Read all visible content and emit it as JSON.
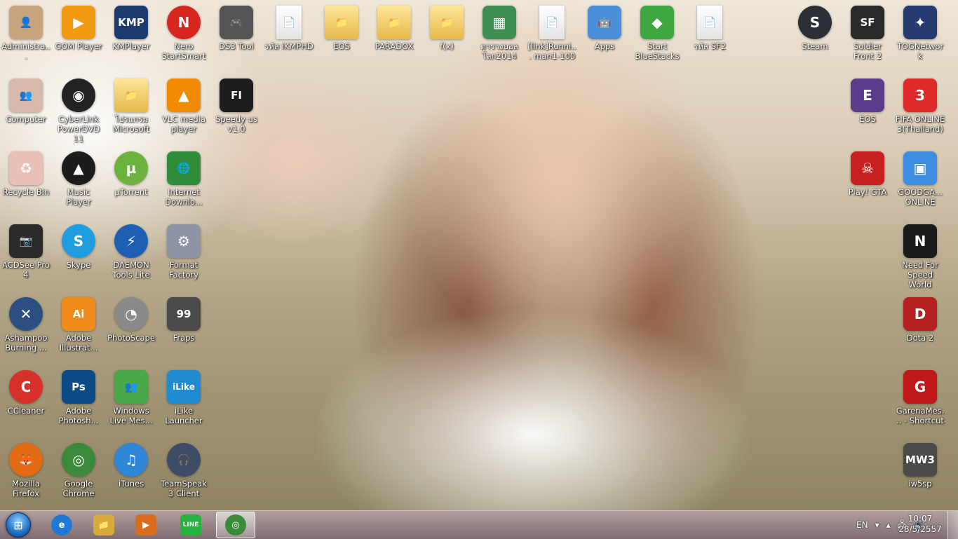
{
  "desktop": {
    "icons": [
      {
        "id": "admin",
        "label": "Administra...",
        "icon": "user-photo-icon",
        "glyph": "👤",
        "bg": "#c9a27e"
      },
      {
        "id": "gom",
        "label": "GOM Player",
        "icon": "gom-player-icon",
        "glyph": "▶",
        "bg": "#f39a14"
      },
      {
        "id": "kmp",
        "label": "KMPlayer",
        "icon": "kmplayer-icon",
        "glyph": "KMP",
        "bg": "#1c3c6e"
      },
      {
        "id": "nero",
        "label": "Nero StartSmart",
        "icon": "nero-icon",
        "glyph": "N",
        "bg": "#d7261e"
      },
      {
        "id": "ds3",
        "label": "DS3 Tool",
        "icon": "gamepad-icon",
        "glyph": "🎮",
        "bg": "#555555"
      },
      {
        "id": "kmphd",
        "label": "รหัส iKMPHD",
        "icon": "document-icon",
        "glyph": "📄",
        "bg": ""
      },
      {
        "id": "eos",
        "label": "EOS",
        "icon": "folder-icon",
        "glyph": "📁",
        "bg": ""
      },
      {
        "id": "paradox",
        "label": "PARADOX",
        "icon": "folder-icon",
        "glyph": "📁",
        "bg": ""
      },
      {
        "id": "fx",
        "label": "f(x)",
        "icon": "folder-icon",
        "glyph": "📁",
        "bg": ""
      },
      {
        "id": "ball",
        "label": "ตารางบอลโลก2014",
        "icon": "spreadsheet-icon",
        "glyph": "▦",
        "bg": "#3f8f55"
      },
      {
        "id": "link",
        "label": "[link]Runni... man1-100",
        "icon": "document-icon",
        "glyph": "📄",
        "bg": ""
      },
      {
        "id": "apps",
        "label": "Apps",
        "icon": "android-apps-icon",
        "glyph": "🤖",
        "bg": "#4a8fd8"
      },
      {
        "id": "bluestacks",
        "label": "Start BlueStacks",
        "icon": "bluestacks-icon",
        "glyph": "◆",
        "bg": "#3fa73f"
      },
      {
        "id": "sf2txt",
        "label": "รหัส SF2",
        "icon": "document-icon",
        "glyph": "📄",
        "bg": ""
      },
      {
        "id": "steam",
        "label": "Steam",
        "icon": "steam-icon",
        "glyph": "S",
        "bg": "#2b2f36"
      },
      {
        "id": "sf2",
        "label": "Soldier Front 2",
        "icon": "soldier-front-icon",
        "glyph": "SF",
        "bg": "#2a2a2a"
      },
      {
        "id": "tog",
        "label": "TOGNetwork",
        "icon": "tog-network-icon",
        "glyph": "✦",
        "bg": "#263c70"
      },
      {
        "id": "computer",
        "label": "Computer",
        "icon": "computer-icon",
        "glyph": "👥",
        "bg": "#d8b8a8"
      },
      {
        "id": "powerdvd",
        "label": "CyberLink PowerDVD 11",
        "icon": "powerdvd-icon",
        "glyph": "◉",
        "bg": "#222222"
      },
      {
        "id": "msfolder",
        "label": "โปรแกรม Microsoft",
        "icon": "folder-icon",
        "glyph": "📁",
        "bg": ""
      },
      {
        "id": "vlc",
        "label": "VLC media player",
        "icon": "vlc-icon",
        "glyph": "▲",
        "bg": "#f08a00"
      },
      {
        "id": "speedy",
        "label": "Speedy us v1.0",
        "icon": "speedy-icon",
        "glyph": "FI",
        "bg": "#1e1e1e"
      },
      {
        "id": "eos2",
        "label": "EOS",
        "icon": "eos-game-icon",
        "glyph": "E",
        "bg": "#5a3b8c"
      },
      {
        "id": "fifa",
        "label": "FIFA ONLINE 3(Thailand)",
        "icon": "fifa-online-icon",
        "glyph": "3",
        "bg": "#e02a2a"
      },
      {
        "id": "recycle",
        "label": "Recycle Bin",
        "icon": "recycle-bin-icon",
        "glyph": "♻",
        "bg": "#e9c0b6"
      },
      {
        "id": "music",
        "label": "Music Player",
        "icon": "music-player-icon",
        "glyph": "▲",
        "bg": "#1c1c1c"
      },
      {
        "id": "utorrent",
        "label": "µTorrent",
        "icon": "utorrent-icon",
        "glyph": "µ",
        "bg": "#6cb23d"
      },
      {
        "id": "idm",
        "label": "Internet Downlo...",
        "icon": "internet-download-icon",
        "glyph": "🌐",
        "bg": "#2f8c3a"
      },
      {
        "id": "gta",
        "label": "Play! GTA",
        "icon": "gta-icon",
        "glyph": "☠",
        "bg": "#c62020"
      },
      {
        "id": "goodgame",
        "label": "GOODGA... ONLINE",
        "icon": "goodgame-icon",
        "glyph": "▣",
        "bg": "#3b8ee0"
      },
      {
        "id": "acdsee",
        "label": "ACDSee Pro 4",
        "icon": "camera-icon",
        "glyph": "📷",
        "bg": "#2a2a2a"
      },
      {
        "id": "skype",
        "label": "Skype",
        "icon": "skype-icon",
        "glyph": "S",
        "bg": "#1e9ee0"
      },
      {
        "id": "daemon",
        "label": "DAEMON Tools Lite",
        "icon": "daemon-tools-icon",
        "glyph": "⚡",
        "bg": "#1f5fb3"
      },
      {
        "id": "format",
        "label": "Format Factory",
        "icon": "format-factory-icon",
        "glyph": "⚙",
        "bg": "#8c94a6"
      },
      {
        "id": "nfs",
        "label": "Need For Speed World",
        "icon": "nfs-icon",
        "glyph": "N",
        "bg": "#1a1a1a"
      },
      {
        "id": "ashampoo",
        "label": "Ashampoo Burning ...",
        "icon": "ashampoo-icon",
        "glyph": "✕",
        "bg": "#2a4f80"
      },
      {
        "id": "illustrator",
        "label": "Adobe Illustrat...",
        "icon": "illustrator-icon",
        "glyph": "Ai",
        "bg": "#f08a18"
      },
      {
        "id": "photoscape",
        "label": "PhotoScape",
        "icon": "photoscape-icon",
        "glyph": "◔",
        "bg": "#8a8a8a"
      },
      {
        "id": "fraps",
        "label": "Fraps",
        "icon": "fraps-icon",
        "glyph": "99",
        "bg": "#4a4a4a"
      },
      {
        "id": "dota",
        "label": "Dota 2",
        "icon": "dota2-icon",
        "glyph": "D",
        "bg": "#b41f1f"
      },
      {
        "id": "ccleaner",
        "label": "CCleaner",
        "icon": "ccleaner-icon",
        "glyph": "C",
        "bg": "#d8302a"
      },
      {
        "id": "photoshop",
        "label": "Adobe Photosh...",
        "icon": "photoshop-icon",
        "glyph": "Ps",
        "bg": "#0d4a86"
      },
      {
        "id": "wlm",
        "label": "Windows Live Mes...",
        "icon": "messenger-icon",
        "glyph": "👥",
        "bg": "#49a84a"
      },
      {
        "id": "ilike",
        "label": "iLike Launcher",
        "icon": "ilike-icon",
        "glyph": "iLike",
        "bg": "#1f8bd0"
      },
      {
        "id": "garena",
        "label": "GarenaMes... - Shortcut",
        "icon": "garena-icon",
        "glyph": "G",
        "bg": "#c01818"
      },
      {
        "id": "firefox",
        "label": "Mozilla Firefox",
        "icon": "firefox-icon",
        "glyph": "🦊",
        "bg": "#e36b14"
      },
      {
        "id": "chrome",
        "label": "Google Chrome",
        "icon": "chrome-icon",
        "glyph": "◎",
        "bg": "#3a8a3a"
      },
      {
        "id": "itunes",
        "label": "iTunes",
        "icon": "itunes-icon",
        "glyph": "♫",
        "bg": "#2f86d6"
      },
      {
        "id": "teamspeak",
        "label": "TeamSpeak 3 Client",
        "icon": "teamspeak-icon",
        "glyph": "🎧",
        "bg": "#3d4b66"
      },
      {
        "id": "iw5sp",
        "label": "iw5sp",
        "icon": "call-of-duty-icon",
        "glyph": "MW3",
        "bg": "#4a4a4a"
      }
    ]
  },
  "taskbar": {
    "start_glyph": "⊞",
    "pinned": [
      {
        "name": "internet-explorer",
        "icon": "internet-explorer-icon",
        "glyph": "e",
        "bg": "#1f78d6"
      },
      {
        "name": "windows-explorer",
        "icon": "folder-icon",
        "glyph": "📁",
        "bg": "#d8aa3c"
      },
      {
        "name": "media-player",
        "icon": "media-player-icon",
        "glyph": "▶",
        "bg": "#d86d1f"
      },
      {
        "name": "line",
        "icon": "line-icon",
        "glyph": "LINE",
        "bg": "#25b33d"
      },
      {
        "name": "chrome",
        "icon": "chrome-icon",
        "glyph": "◎",
        "bg": "#3a8a3a"
      }
    ],
    "tray": {
      "language": "EN",
      "flag_glyph": "▾",
      "arrow_glyph": "▴",
      "network_glyph": "🖧",
      "volume_glyph": "🔊"
    },
    "clock": {
      "time": "10:07",
      "date": "28/5/2557"
    }
  }
}
